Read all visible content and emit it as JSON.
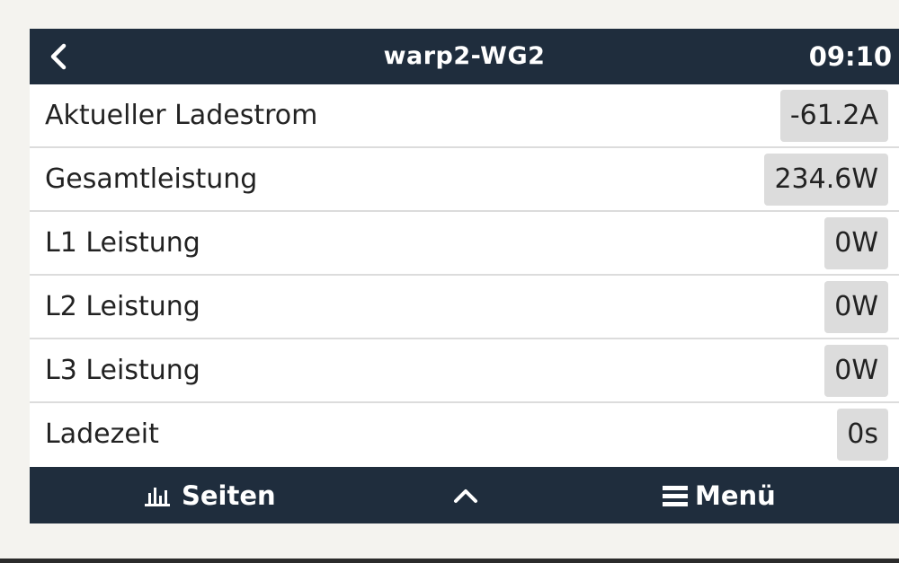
{
  "header": {
    "title": "warp2-WG2",
    "clock": "09:10",
    "back_icon": "chevron-left-icon"
  },
  "rows": [
    {
      "label": "Aktueller Ladestrom",
      "value": "-61.2A"
    },
    {
      "label": "Gesamtleistung",
      "value": "234.6W"
    },
    {
      "label": "L1 Leistung",
      "value": "0W"
    },
    {
      "label": "L2 Leistung",
      "value": "0W"
    },
    {
      "label": "L3 Leistung",
      "value": "0W"
    },
    {
      "label": "Ladezeit",
      "value": "0s"
    }
  ],
  "footer": {
    "pages_label": "Seiten",
    "pages_icon": "bar-chart-icon",
    "up_icon": "chevron-up-icon",
    "menu_label": "Menü",
    "menu_icon": "hamburger-icon"
  },
  "colors": {
    "bar_background": "#1f2d3d",
    "value_box": "#dcdcdc",
    "divider": "#dcdcdc",
    "page_background": "#f4f3ef"
  }
}
